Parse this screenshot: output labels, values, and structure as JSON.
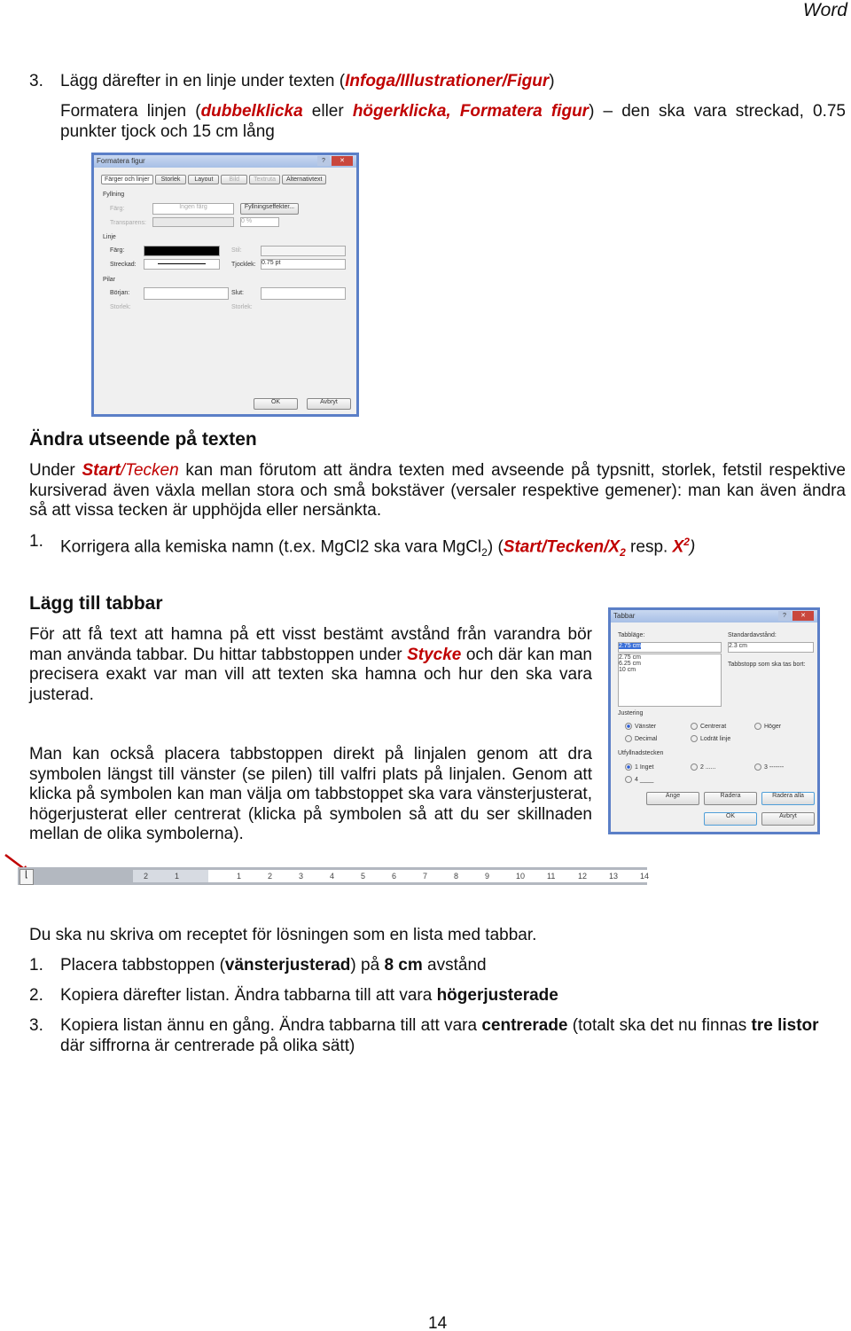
{
  "header": "Word",
  "step3": {
    "num": "3.",
    "pre": "Lägg därefter in en linje under texten (",
    "path": "Infoga/Illustrationer/Figur",
    "post": ")"
  },
  "step3b": {
    "pre": "Formatera linjen (",
    "a": "dubbelklicka",
    "mid": " eller ",
    "b": "högerklicka, Formatera figur",
    "post": ") – den ska vara streckad, 0.75 punkter tjock och 15 cm lång"
  },
  "dialog1": {
    "title": "Formatera figur",
    "tabs": [
      "Färger och linjer",
      "Storlek",
      "Layout",
      "Bild",
      "Textruta",
      "Alternativtext"
    ],
    "fill_section": "Fyllning",
    "color_label": "Färg:",
    "color_value": "Ingen färg",
    "fill_effects": "Fyllningseffekter...",
    "transparency_label": "Transparens:",
    "transparency_value": "0 %",
    "line_section": "Linje",
    "line_color_label": "Färg:",
    "style_label": "Stil:",
    "dash_label": "Streckad:",
    "weight_label": "Tjocklek:",
    "weight_value": "0.75 pt",
    "arrows_section": "Pilar",
    "begin_label": "Början:",
    "end_label": "Slut:",
    "begin_size_label": "Storlek:",
    "end_size_label": "Storlek:",
    "ok": "OK",
    "cancel": "Avbryt"
  },
  "section1": {
    "title": "Ändra utseende på texten",
    "para_pre": "Under ",
    "para_path1": "Start",
    "para_path2": "/Tecken",
    "para_post": " kan man förutom att ändra texten med avseende på typsnitt, storlek, fetstil respektive kursiverad även växla mellan stora och små bokstäver (versaler respektive gemener): man kan även ändra så att vissa tecken är upphöjda eller nersänkta.",
    "item_num": "1.",
    "item_pre": "Korrigera alla kemiska namn (t.ex. MgCl2 ska vara MgCl",
    "item_sub": "2",
    "item_mid": ") (",
    "item_path": "Start/Tecken/X",
    "item_path_sub": "2",
    "item_resp": " resp. ",
    "item_x": "X",
    "item_sup": "2",
    "item_end": ")"
  },
  "section2": {
    "title": "Lägg till tabbar",
    "para1_pre": "För att få text att hamna på ett visst bestämt avstånd från varandra bör man använda tabbar. Du hittar tabbstoppen under ",
    "para1_path": "Stycke",
    "para1_post": " och där kan man precisera exakt var man vill att texten ska hamna och hur den ska vara justerad.",
    "para2": "Man kan också placera tabbstoppen direkt på linjalen genom att dra symbolen längst till vänster (se pilen) till valfri plats på linjalen. Genom att klicka på symbolen kan man välja om tabbstoppet ska vara vänsterjusterat, högerjusterat eller centrerat (klicka på symbolen så att du ser skillnaden mellan de olika symbolerna)."
  },
  "dialog2": {
    "title": "Tabbar",
    "tab_pos_label": "Tabbläge:",
    "tab_pos_value": "2.75 cm",
    "tab_list": [
      "2.75 cm",
      "6.25 cm",
      "10 cm"
    ],
    "default_label": "Standardavstånd:",
    "default_value": "2.3 cm",
    "remove_label": "Tabbstopp som ska tas bort:",
    "align_section": "Justering",
    "align": [
      "Vänster",
      "Centrerat",
      "Höger",
      "Decimal",
      "Lodrät linje"
    ],
    "leader_section": "Utfyllnadstecken",
    "leaders": [
      "1 Inget",
      "2 ......",
      "3 -------",
      "4 ____"
    ],
    "set": "Ange",
    "clear": "Radera",
    "clear_all": "Radera alla",
    "ok": "OK",
    "cancel": "Avbryt"
  },
  "ruler": {
    "ticks": [
      "2",
      "1",
      "1",
      "2",
      "3",
      "4",
      "5",
      "6",
      "7",
      "8",
      "9",
      "10",
      "11",
      "12",
      "13",
      "14"
    ]
  },
  "task": {
    "intro": "Du ska nu skriva om receptet för lösningen som en lista med tabbar.",
    "i1_num": "1.",
    "i1_pre": "Placera tabbstoppen (",
    "i1_b1": "vänsterjusterad",
    "i1_mid": ") på ",
    "i1_b2": "8 cm",
    "i1_post": " avstånd",
    "i2_num": "2.",
    "i2_pre": "Kopiera därefter listan. Ändra tabbarna till att vara ",
    "i2_b": "högerjusterade",
    "i3_num": "3.",
    "i3_pre": "Kopiera listan ännu en gång. Ändra tabbarna till att vara ",
    "i3_b1": "centrerade",
    "i3_mid": " (totalt ska det nu finnas ",
    "i3_b2": "tre listor",
    "i3_post": " där siffrorna är centrerade på olika sätt)"
  },
  "page_number": "14",
  "colors": {
    "accent": "#c00000"
  }
}
